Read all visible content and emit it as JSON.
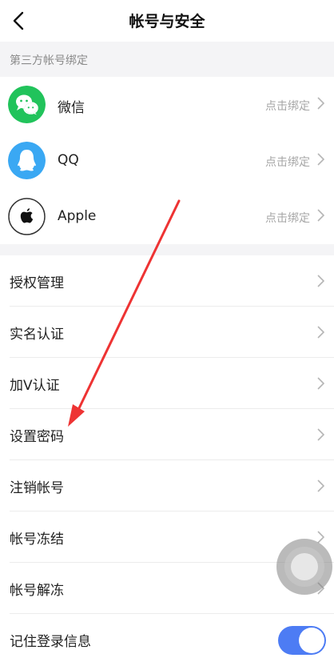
{
  "header": {
    "title": "帐号与安全"
  },
  "third_party": {
    "section_title": "第三方帐号绑定",
    "items": [
      {
        "name": "微信",
        "action": "点击绑定",
        "icon": "wechat-icon",
        "color": "#21c35b"
      },
      {
        "name": "QQ",
        "action": "点击绑定",
        "icon": "qq-icon",
        "color": "#3aa8f3"
      },
      {
        "name": "Apple",
        "action": "点击绑定",
        "icon": "apple-icon",
        "color": "#ffffff"
      }
    ]
  },
  "menu": {
    "items": [
      {
        "label": "授权管理"
      },
      {
        "label": "实名认证"
      },
      {
        "label": "加V认证"
      },
      {
        "label": "设置密码"
      },
      {
        "label": "注销帐号"
      },
      {
        "label": "帐号冻结"
      },
      {
        "label": "帐号解冻"
      }
    ],
    "remember_login": {
      "label": "记住登录信息",
      "enabled": true
    }
  },
  "colors": {
    "accent": "#4d7cf4",
    "annotation_arrow": "#ee3333"
  }
}
